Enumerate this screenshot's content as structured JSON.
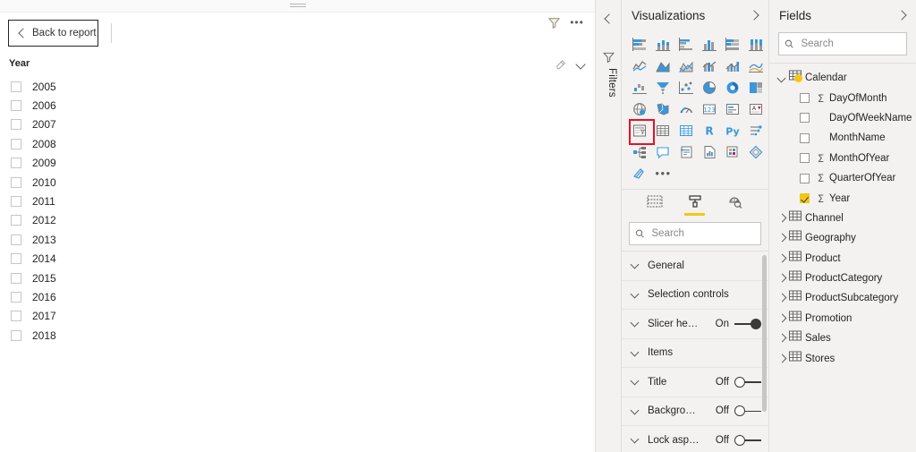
{
  "canvas": {
    "drag_handle": "drag-handle",
    "back_button_label": "Back to report",
    "header_icons": [
      "filter-icon",
      "more-options-icon"
    ],
    "slicer": {
      "title": "Year",
      "head_icons": [
        "eraser-clear-selections-icon",
        "chevron-down-icon"
      ],
      "items": [
        {
          "label": "2005",
          "checked": false
        },
        {
          "label": "2006",
          "checked": false
        },
        {
          "label": "2007",
          "checked": false
        },
        {
          "label": "2008",
          "checked": false
        },
        {
          "label": "2009",
          "checked": false
        },
        {
          "label": "2010",
          "checked": false
        },
        {
          "label": "2011",
          "checked": false
        },
        {
          "label": "2012",
          "checked": false
        },
        {
          "label": "2013",
          "checked": false
        },
        {
          "label": "2014",
          "checked": false
        },
        {
          "label": "2015",
          "checked": false
        },
        {
          "label": "2016",
          "checked": false
        },
        {
          "label": "2017",
          "checked": false
        },
        {
          "label": "2018",
          "checked": false
        }
      ]
    }
  },
  "filters_rail": {
    "label": "Filters",
    "collapse_icon": "chevron-left-icon",
    "filter_icon": "filter-icon"
  },
  "visualizations": {
    "title": "Visualizations",
    "expand_icon": "chevron-right-icon",
    "selected_icon": "slicer-icon",
    "highlight_color": "#e81123",
    "accent_color": "#f2c811",
    "icons": [
      "stacked-bar-chart-icon",
      "stacked-column-chart-icon",
      "clustered-bar-chart-icon",
      "clustered-column-chart-icon",
      "100-percent-stacked-bar-chart-icon",
      "100-percent-stacked-column-chart-icon",
      "line-chart-icon",
      "area-chart-icon",
      "stacked-area-chart-icon",
      "line-and-stacked-column-chart-icon",
      "line-and-clustered-column-chart-icon",
      "ribbon-chart-icon",
      "waterfall-chart-icon",
      "funnel-chart-icon",
      "scatter-chart-icon",
      "pie-chart-icon",
      "donut-chart-icon",
      "treemap-icon",
      "map-icon",
      "filled-map-icon",
      "gauge-icon",
      "card-icon",
      "multi-row-card-icon",
      "kpi-icon",
      "slicer-icon",
      "table-icon",
      "matrix-icon",
      "r-script-visual-icon",
      "python-visual-icon",
      "key-influencers-icon",
      "decomposition-tree-icon",
      "q-and-a-icon",
      "smart-narrative-icon",
      "paginated-report-icon",
      "power-apps-icon",
      "power-automate-icon",
      "arcgis-maps-icon",
      "more-visuals-icon"
    ],
    "tabs": [
      {
        "name": "fields-tab",
        "label": "Fields",
        "active": false
      },
      {
        "name": "format-tab",
        "label": "Format",
        "active": true
      },
      {
        "name": "analytics-tab",
        "label": "Analytics",
        "active": false
      }
    ],
    "search": {
      "placeholder": "Search",
      "value": ""
    },
    "format_rows": [
      {
        "label": "General",
        "toggle": null
      },
      {
        "label": "Selection controls",
        "toggle": null
      },
      {
        "label": "Slicer he…",
        "toggle": "On"
      },
      {
        "label": "Items",
        "toggle": null
      },
      {
        "label": "Title",
        "toggle": "Off"
      },
      {
        "label": "Backgro…",
        "toggle": "Off"
      },
      {
        "label": "Lock asp…",
        "toggle": "Off"
      }
    ]
  },
  "fields": {
    "title": "Fields",
    "expand_icon": "chevron-right-icon",
    "search": {
      "placeholder": "Search",
      "value": ""
    },
    "tables": [
      {
        "name": "Calendar",
        "expanded": true,
        "is_date_table": true,
        "fields": [
          {
            "label": "DayOfMonth",
            "checked": false,
            "aggregate": true
          },
          {
            "label": "DayOfWeekName",
            "checked": false,
            "aggregate": false
          },
          {
            "label": "MonthName",
            "checked": false,
            "aggregate": false
          },
          {
            "label": "MonthOfYear",
            "checked": false,
            "aggregate": true
          },
          {
            "label": "QuarterOfYear",
            "checked": false,
            "aggregate": true
          },
          {
            "label": "Year",
            "checked": true,
            "aggregate": true
          }
        ]
      },
      {
        "name": "Channel",
        "expanded": false,
        "is_date_table": false,
        "fields": []
      },
      {
        "name": "Geography",
        "expanded": false,
        "is_date_table": false,
        "fields": []
      },
      {
        "name": "Product",
        "expanded": false,
        "is_date_table": false,
        "fields": []
      },
      {
        "name": "ProductCategory",
        "expanded": false,
        "is_date_table": false,
        "fields": []
      },
      {
        "name": "ProductSubcategory",
        "expanded": false,
        "is_date_table": false,
        "fields": []
      },
      {
        "name": "Promotion",
        "expanded": false,
        "is_date_table": false,
        "fields": []
      },
      {
        "name": "Sales",
        "expanded": false,
        "is_date_table": false,
        "fields": []
      },
      {
        "name": "Stores",
        "expanded": false,
        "is_date_table": false,
        "fields": []
      }
    ]
  }
}
